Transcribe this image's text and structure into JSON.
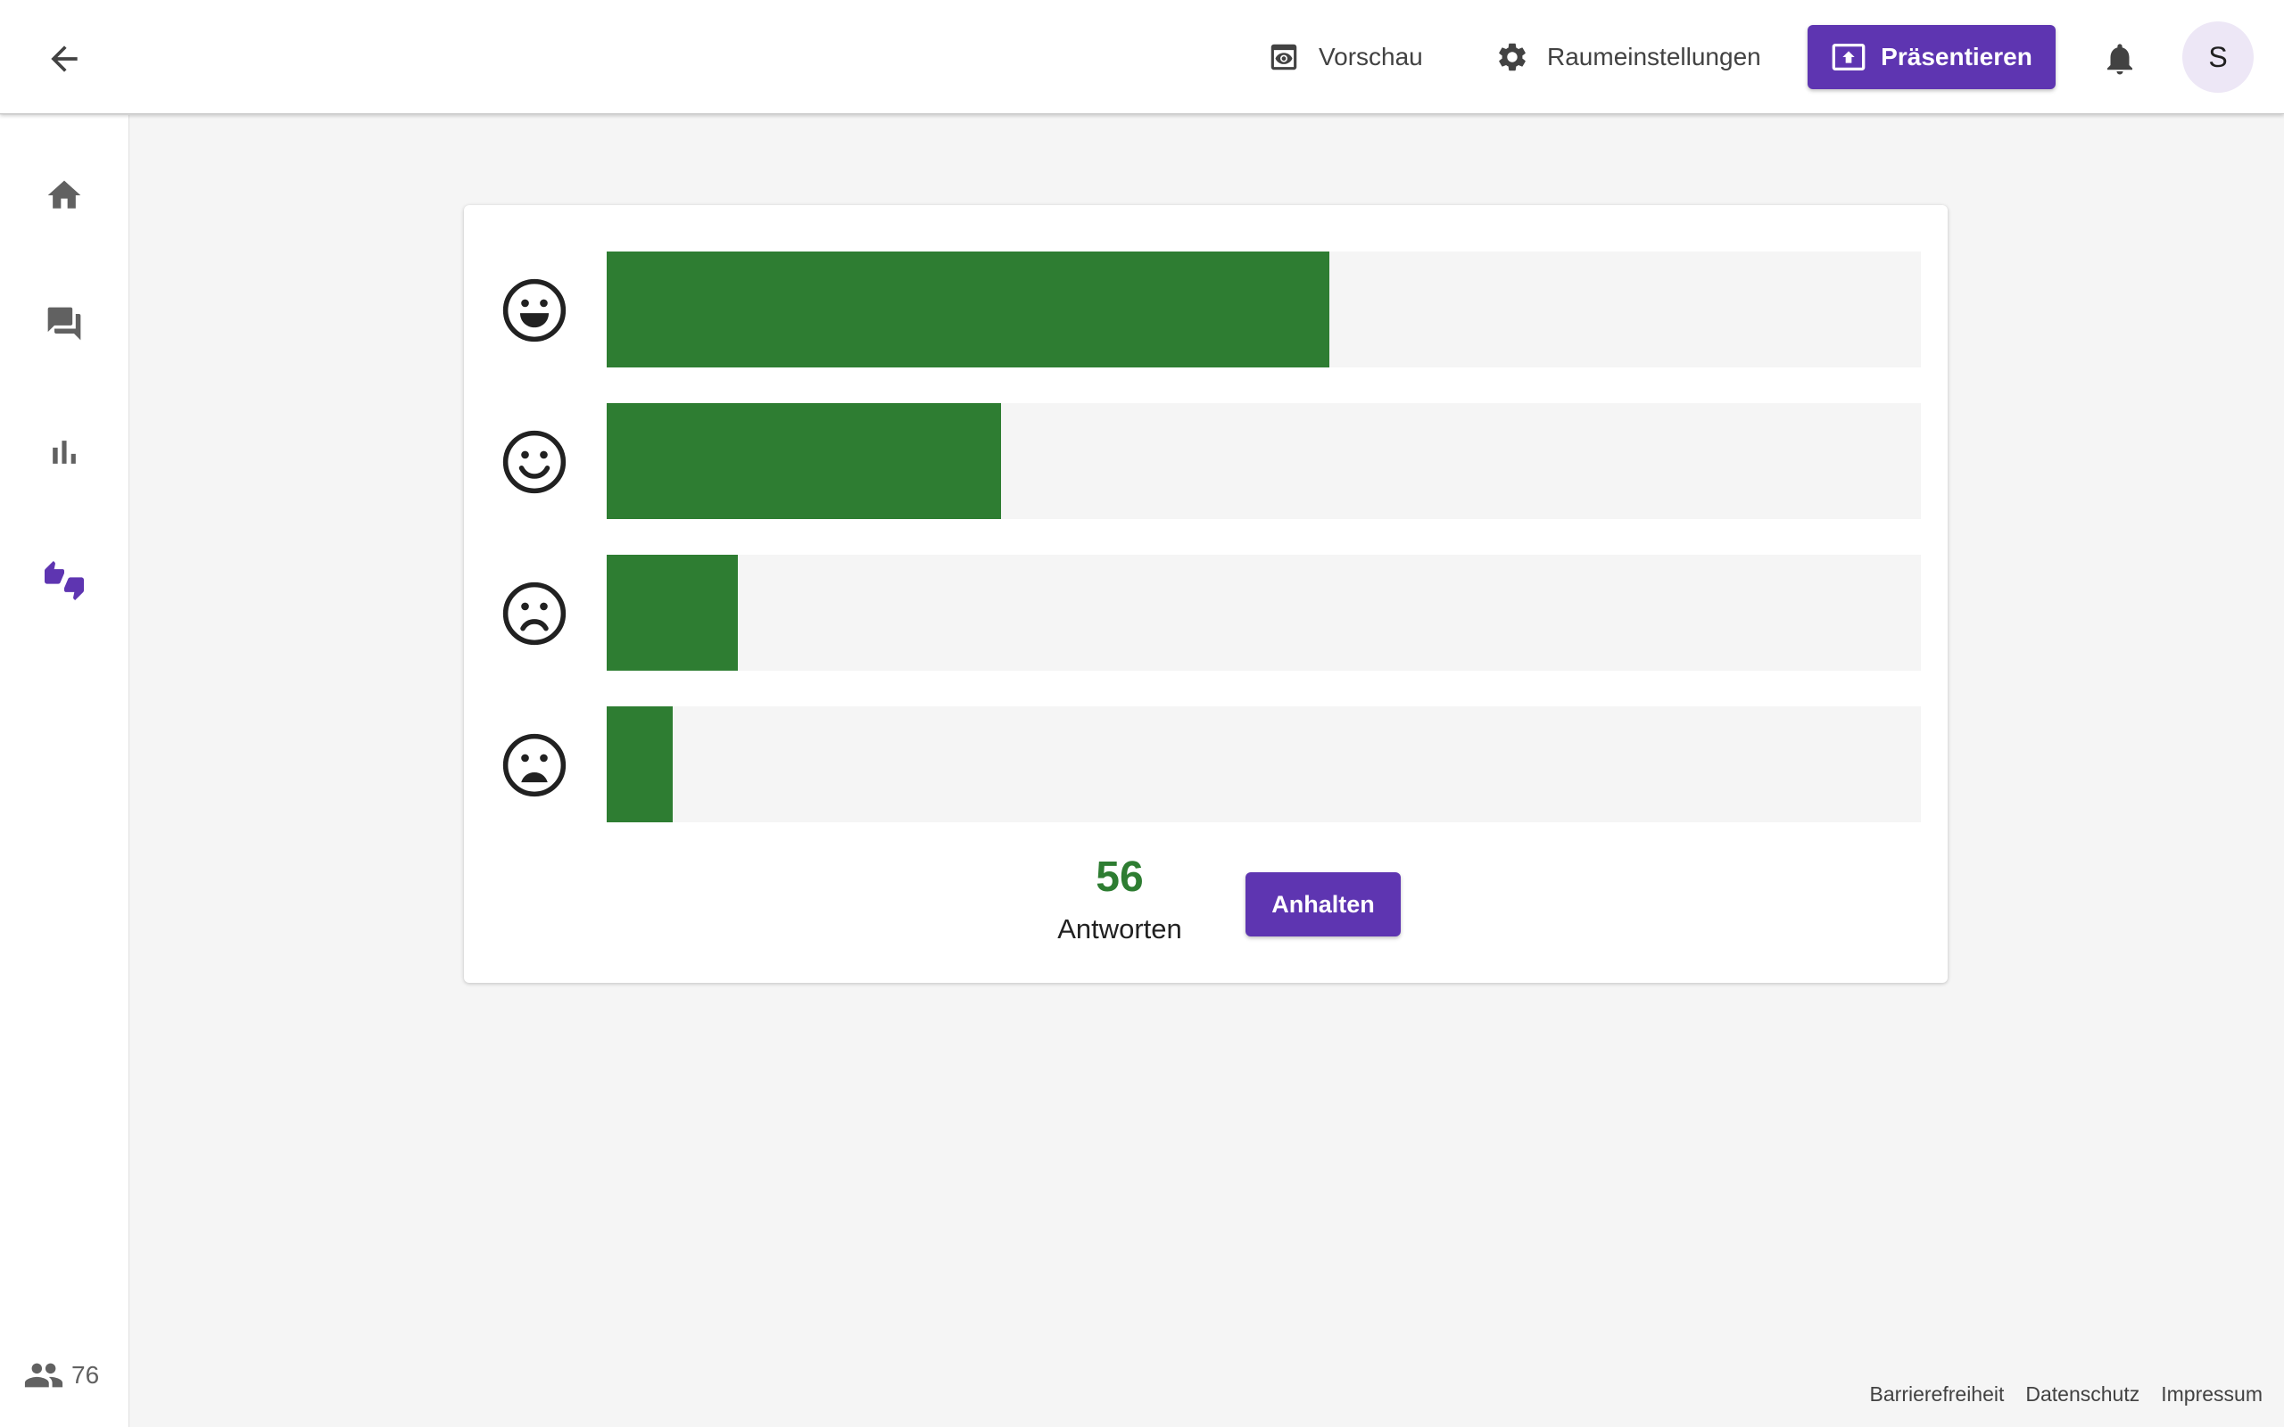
{
  "topbar": {
    "back_icon": "arrow-back-icon",
    "preview_label": "Vorschau",
    "preview_icon": "preview-eye-icon",
    "settings_label": "Raumeinstellungen",
    "settings_icon": "gear-icon",
    "present_label": "Präsentieren",
    "present_icon": "present-to-all-icon",
    "notifications_icon": "bell-icon",
    "avatar_initial": "S"
  },
  "sidebar": {
    "items": [
      {
        "icon": "home-icon",
        "active": false
      },
      {
        "icon": "forum-icon",
        "active": false
      },
      {
        "icon": "bar-chart-icon",
        "active": false
      },
      {
        "icon": "thumbs-up-down-icon",
        "active": true
      }
    ],
    "participants_icon": "people-icon",
    "participants_count": "76"
  },
  "feedback": {
    "rows": [
      {
        "mood": "very-happy",
        "icon": "grinning-face-icon",
        "share": 0.55
      },
      {
        "mood": "happy",
        "icon": "smiling-face-icon",
        "share": 0.3
      },
      {
        "mood": "sad",
        "icon": "frowning-face-icon",
        "share": 0.1
      },
      {
        "mood": "very-sad",
        "icon": "anguished-face-icon",
        "share": 0.05
      }
    ],
    "answer_count": "56",
    "answer_label": "Antworten",
    "stop_label": "Anhalten"
  },
  "colors": {
    "accent": "#5e35b1",
    "bar_fill": "#2e7d32",
    "bar_track": "#f5f5f5",
    "count_text": "#2e7d32"
  },
  "footer": {
    "links": [
      "Barrierefreiheit",
      "Datenschutz",
      "Impressum"
    ]
  }
}
